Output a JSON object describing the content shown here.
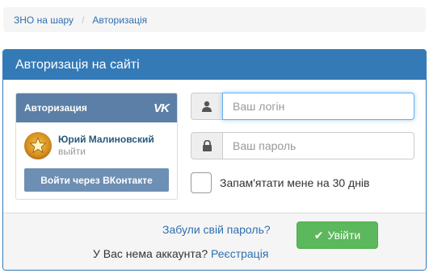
{
  "breadcrumb": {
    "home": "ЗНО на шару",
    "separator": "/",
    "current": "Авторизація"
  },
  "panel": {
    "title": "Авторизація на сайті"
  },
  "vk": {
    "header": "Авторизация",
    "logo": "VK",
    "user_name": "Юрий Малиновский",
    "logout": "выйти",
    "login_button": "Войти через ВКонтакте"
  },
  "form": {
    "login_placeholder": "Ваш логін",
    "password_placeholder": "Ваш пароль",
    "remember_label": "Запам'ятати мене на 30 днів",
    "forgot_link": "Забули свій пароль?",
    "submit_label": "Увійти",
    "no_account_text": "У Вас нема аккаунта?",
    "register_link": "Реєстрація"
  },
  "colors": {
    "panel": "#337ab7",
    "vk": "#5b7fa6",
    "success": "#5cb85c",
    "link": "#2f6fb0"
  }
}
